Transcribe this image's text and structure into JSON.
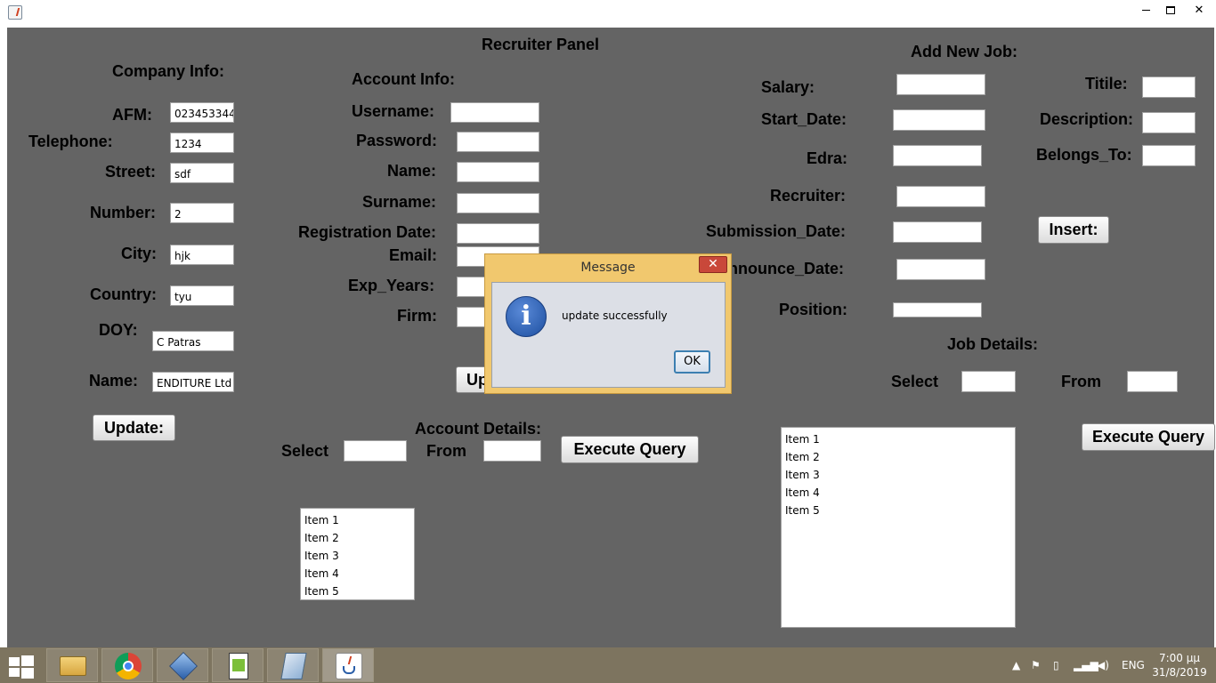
{
  "window": {
    "min_icon": "minimize-icon",
    "max_icon": "maximize-icon",
    "close_icon": "close-icon",
    "close_glyph": "✕"
  },
  "panel": {
    "title": "Recruiter Panel",
    "company": {
      "heading": "Company Info:",
      "afm_label": "AFM:",
      "afm_value": "023453344",
      "telephone_label": "Telephone:",
      "telephone_value": "1234",
      "street_label": "Street:",
      "street_value": "sdf",
      "number_label": "Number:",
      "number_value": "2",
      "city_label": "City:",
      "city_value": "hjk",
      "country_label": "Country:",
      "country_value": "tyu",
      "doy_label": "DOY:",
      "doy_value": "C Patras",
      "name_label": "Name:",
      "name_value": "ENDITURE Ltd",
      "update_button": "Update:"
    },
    "account": {
      "heading": "Account Info:",
      "username_label": "Username:",
      "password_label": "Password:",
      "name_label": "Name:",
      "surname_label": "Surname:",
      "regdate_label": "Registration Date:",
      "email_label": "Email:",
      "expyears_label": "Exp_Years:",
      "firm_label": "Firm:",
      "update_button": "Up"
    },
    "account_details": {
      "heading": "Account Details:",
      "select_label": "Select",
      "from_label": "From",
      "execute_button": "Execute Query",
      "items": [
        "Item 1",
        "Item 2",
        "Item 3",
        "Item 4",
        "Item 5"
      ]
    },
    "new_job": {
      "heading": "Add New Job:",
      "salary_label": "Salary:",
      "start_date_label": "Start_Date:",
      "edra_label": "Edra:",
      "recruiter_label": "Recruiter:",
      "submission_date_label": "Submission_Date:",
      "announce_date_label": "nnounce_Date:",
      "position_label": "Position:",
      "title_label": "Titile:",
      "description_label": "Description:",
      "belongs_to_label": "Belongs_To:",
      "insert_button": "Insert:"
    },
    "job_details": {
      "heading": "Job Details:",
      "select_label": "Select",
      "from_label": "From",
      "execute_button": "Execute Query",
      "items": [
        "Item 1",
        "Item 2",
        "Item 3",
        "Item 4",
        "Item 5"
      ]
    }
  },
  "dialog": {
    "title": "Message",
    "close_glyph": "✕",
    "icon": "information-icon",
    "icon_glyph": "i",
    "message": "update successfully",
    "ok_button": "OK"
  },
  "taskbar": {
    "apps": [
      "file-explorer-icon",
      "chrome-icon",
      "virtualbox-icon",
      "notepad-plus-plus-icon",
      "sticky-app-icon",
      "java-icon"
    ],
    "language": "ENG",
    "time": "7:00 μμ",
    "date": "31/8/2019",
    "colors": {
      "taskbar": "#7d745f",
      "panel_bg": "#646464",
      "dialog_frame": "#f1c86e"
    }
  }
}
